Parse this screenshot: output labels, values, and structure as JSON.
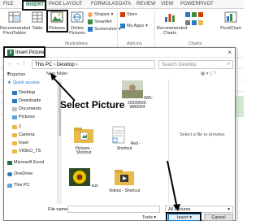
{
  "ribbon": {
    "tabs": [
      "FILE",
      "INSERT",
      "PAGE LAYOUT",
      "FORMULAS",
      "DATA",
      "REVIEW",
      "VIEW",
      "POWERPIVOT"
    ],
    "active_tab": "INSERT",
    "buttons": {
      "recommended_pivot": "Recommended PivotTables",
      "table": "Table",
      "pictures": "Pictures",
      "online_pictures": "Online Pictures",
      "shapes": "Shapes",
      "smartart": "SmartArt",
      "screenshot": "Screenshot",
      "store": "Store",
      "my_apps": "My Apps",
      "recommended_charts": "Recommended Charts",
      "pivotchart": "PivotChart"
    },
    "groups": {
      "illustrations": "Illustrations",
      "addins": "Add-ins",
      "charts": "Charts"
    }
  },
  "dialog": {
    "title": "Insert Picture",
    "address": "This PC  ›  Desktop  ›",
    "search_placeholder": "Search Desktop",
    "organize": "Organize",
    "new_folder": "New folder",
    "nav_items": [
      "Quick access",
      "Desktop",
      "Downloads",
      "Documents",
      "Pictures",
      "2",
      "Camera",
      "Inset",
      "VIDEO_TS",
      "Microsoft Excel",
      "OneDrive",
      "This PC"
    ],
    "files": [
      {
        "label": "IMG-20200503-WA0004",
        "kind": "photo"
      },
      {
        "label": "Pictures - Shortcut",
        "kind": "folder"
      },
      {
        "label": "Red - Shortcut",
        "kind": "doc"
      },
      {
        "label": "sun",
        "kind": "flower"
      },
      {
        "label": "Videos - Shortcut",
        "kind": "video"
      }
    ],
    "preview_text": "Select a file to preview.",
    "file_name_label": "File name:",
    "filter": "All Pictures",
    "tools": "Tools",
    "insert": "Insert",
    "cancel": "Cancel"
  },
  "annotation": "Select Picture",
  "colors": {
    "excel_green": "#217346",
    "folder": "#e9b949",
    "dialog_border": "#7a7a7a"
  }
}
